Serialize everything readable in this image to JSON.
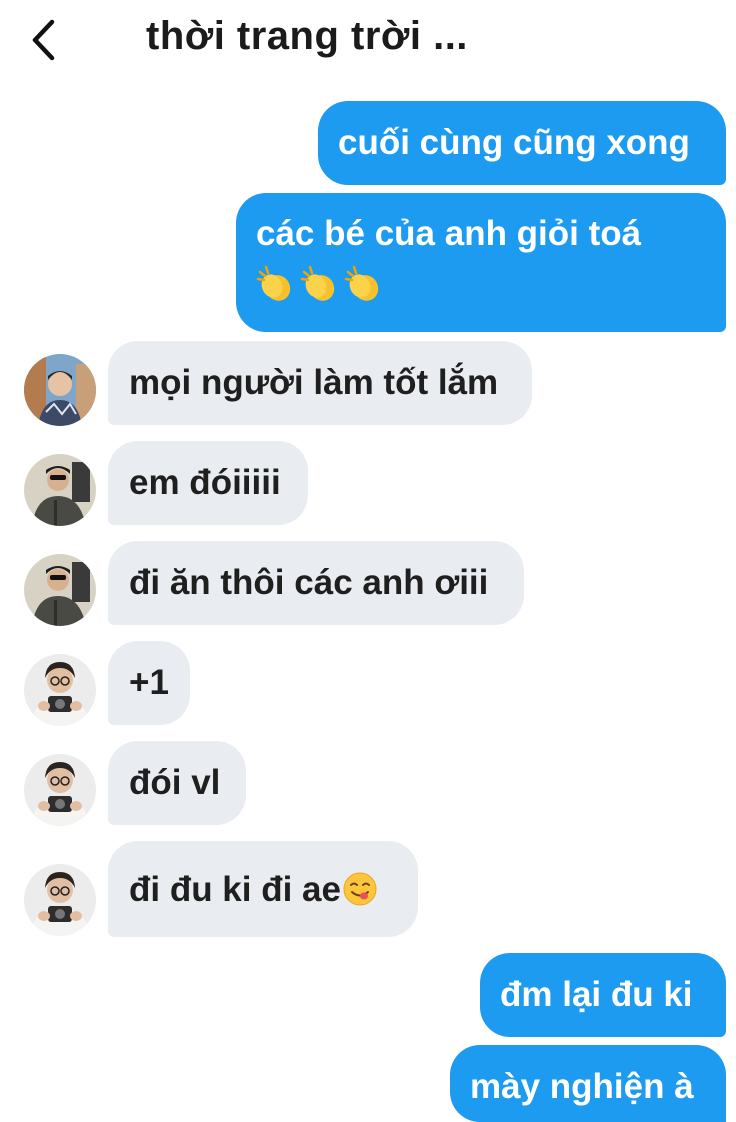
{
  "header": {
    "title": "thời trang trời ...",
    "back_icon": "chevron-left-icon"
  },
  "messages": [
    {
      "direction": "outgoing",
      "text": "cuối cùng cũng xong"
    },
    {
      "direction": "outgoing",
      "text": "các bé của anh giỏi toá",
      "emoji": [
        "clapping-hands-icon",
        "clapping-hands-icon",
        "clapping-hands-icon"
      ]
    },
    {
      "direction": "incoming",
      "text": "mọi người làm tốt lắm",
      "avatar": "avatar-1"
    },
    {
      "direction": "incoming",
      "text": "em đóiiiii",
      "avatar": "avatar-2"
    },
    {
      "direction": "incoming",
      "text": "đi ăn thôi các anh ơiii",
      "avatar": "avatar-2"
    },
    {
      "direction": "incoming",
      "text": "+1",
      "avatar": "avatar-3"
    },
    {
      "direction": "incoming",
      "text": "đói vl",
      "avatar": "avatar-3"
    },
    {
      "direction": "incoming",
      "text": "đi đu ki đi ae",
      "emoji": [
        "savoring-face-icon"
      ],
      "avatar": "avatar-3"
    },
    {
      "direction": "outgoing",
      "text": "đm lại đu ki"
    },
    {
      "direction": "outgoing",
      "text": "mày nghiện à"
    }
  ],
  "colors": {
    "outgoing_bubble": "#1d9bf0",
    "incoming_bubble": "#e9ecf0",
    "title_text": "#1b1b1b"
  }
}
